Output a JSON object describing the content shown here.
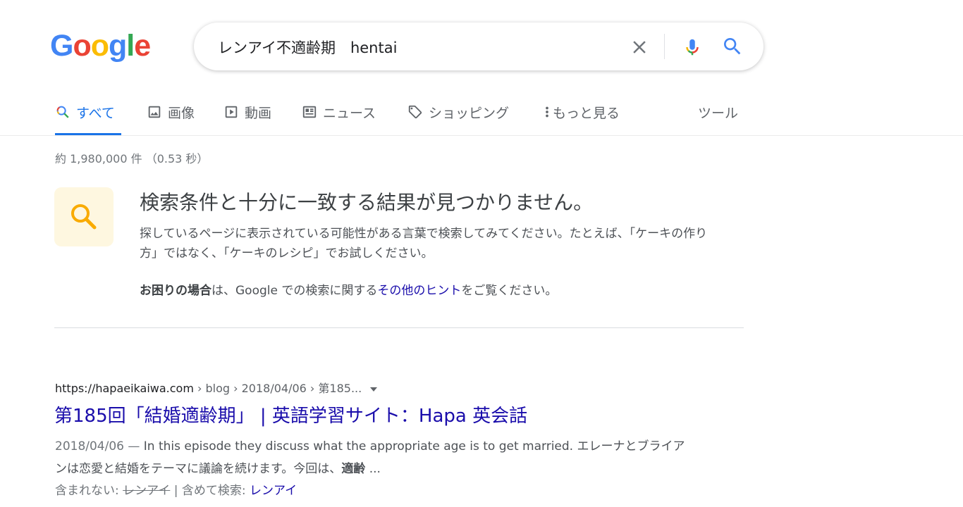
{
  "logo": {
    "letters": [
      "G",
      "o",
      "o",
      "g",
      "l",
      "e"
    ],
    "colors": [
      "#4285F4",
      "#EA4335",
      "#FBBC05",
      "#4285F4",
      "#34A853",
      "#EA4335"
    ]
  },
  "search": {
    "query": "レンアイ不適齢期　hentai",
    "clear_icon": "close-icon",
    "mic_icon": "mic-icon",
    "search_icon": "search-icon"
  },
  "tabs": [
    {
      "label": "すべて",
      "icon": "search-icon",
      "active": true
    },
    {
      "label": "画像",
      "icon": "image-icon"
    },
    {
      "label": "動画",
      "icon": "play-icon"
    },
    {
      "label": "ニュース",
      "icon": "news-icon"
    },
    {
      "label": "ショッピング",
      "icon": "tag-icon"
    },
    {
      "label": "もっと見る",
      "icon": "more-vert-icon"
    }
  ],
  "tools_label": "ツール",
  "stats": "約 1,980,000 件 （0.53 秒）",
  "no_results": {
    "title": "検索条件と十分に一致する結果が見つかりません。",
    "suggestion": "探しているページに表示されている可能性がある言葉で検索してみてください。たとえば、「ケーキの作り方」ではなく、「ケーキのレシピ」でお試しください。",
    "help_bold": "お困りの場合",
    "help_mid": "は、Google での検索に関する",
    "help_link": "その他のヒント",
    "help_end": "をご覧ください。"
  },
  "result": {
    "domain": "https://hapaeikaiwa.com",
    "path": " › blog › 2018/04/06 › 第185...",
    "title": "第185回「結婚適齢期」 | 英語学習サイト：Hapa 英会話",
    "date": "2018/04/06 — ",
    "snippet": "In this episode they discuss what the appropriate age is to get married. エレーナとブライアンは恋愛と結婚をテーマに議論を続けます。今回は、",
    "snippet_bold": "適齢",
    "snippet_end": " ...",
    "missing_label": "含まれない: ",
    "missing_term": "レンアイ",
    "must_include_label": " | 含めて検索: ",
    "must_include_term": "レンアイ"
  },
  "colors": {
    "accent": "#1a73e8",
    "link": "#1a0dab",
    "nores_bg": "#fef7e0",
    "nores_icon": "#f9ab00"
  }
}
